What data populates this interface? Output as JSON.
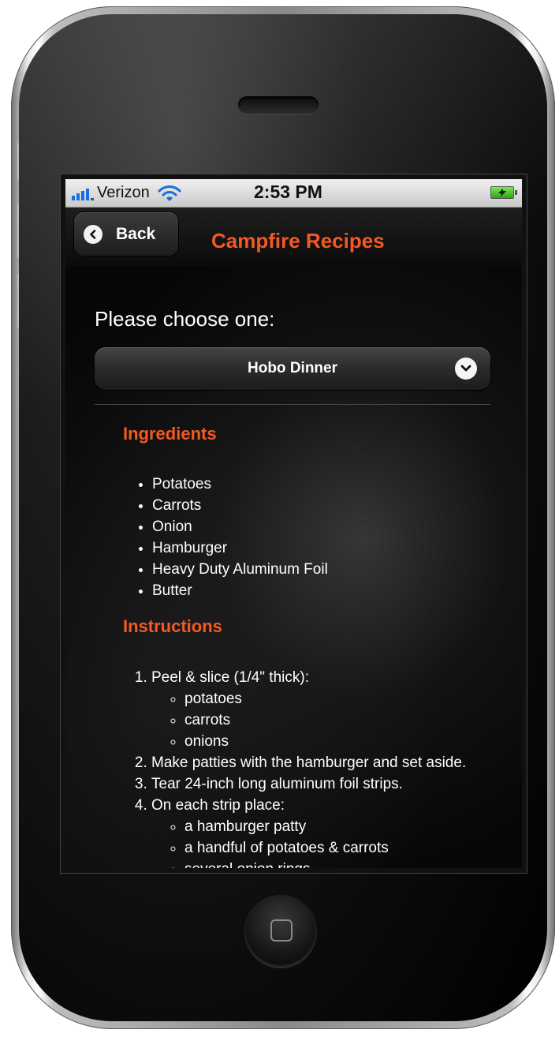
{
  "status_bar": {
    "carrier": "Verizon",
    "time": "2:53 PM",
    "signal_icon": "signal-bars-icon",
    "wifi_icon": "wifi-icon",
    "battery_icon": "battery-charging-icon"
  },
  "nav": {
    "back_label": "Back",
    "back_icon": "chevron-left-icon",
    "title": "Campfire Recipes"
  },
  "chooser": {
    "prompt": "Please choose one:",
    "selected": "Hobo Dinner",
    "chevron_icon": "chevron-down-icon"
  },
  "ingredients": {
    "heading": "Ingredients",
    "items": [
      "Potatoes",
      "Carrots",
      "Onion",
      "Hamburger",
      "Heavy Duty Aluminum Foil",
      "Butter"
    ]
  },
  "instructions": {
    "heading": "Instructions",
    "steps": [
      {
        "text": "Peel & slice (1/4\" thick):",
        "sub": [
          "potatoes",
          "carrots",
          "onions"
        ]
      },
      {
        "text": "Make patties with the hamburger and set aside."
      },
      {
        "text": "Tear 24-inch long aluminum foil strips."
      },
      {
        "text": "On each strip place:",
        "sub": [
          "a hamburger patty",
          "a handful of potatoes & carrots",
          "several onion rings"
        ]
      }
    ]
  },
  "colors": {
    "accent": "#f25a24",
    "background": "#070707",
    "text": "#ffffff",
    "signal": "#1a6de0"
  }
}
